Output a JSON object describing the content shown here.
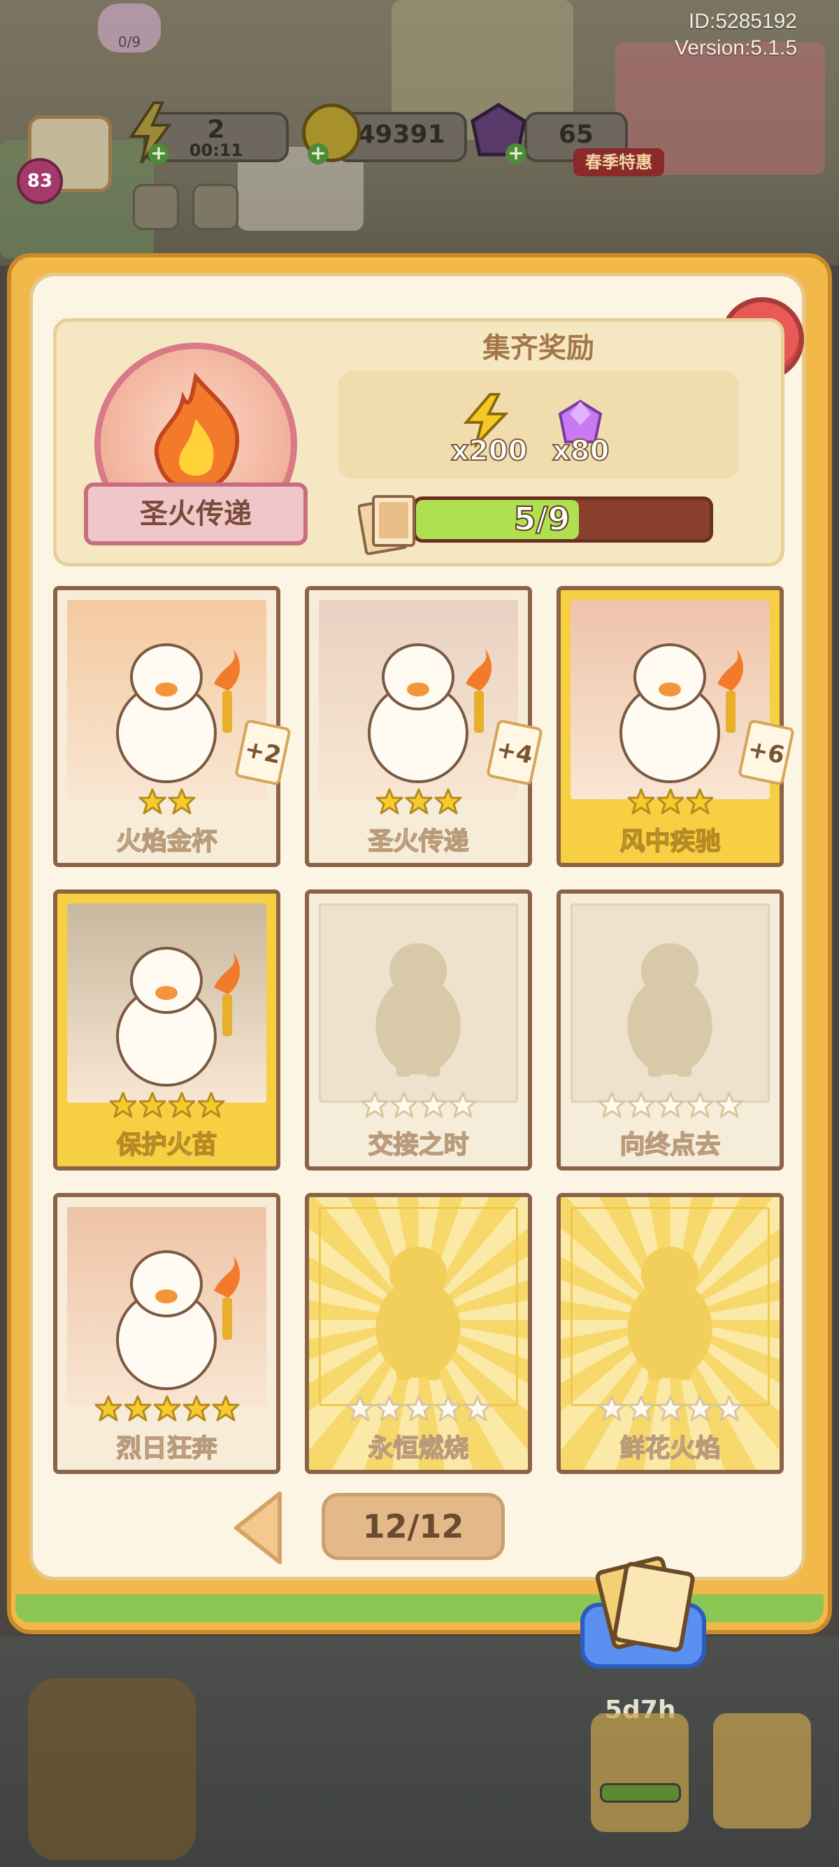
{
  "system": {
    "id_label": "ID:5285192",
    "version_label": "Version:5.1.5"
  },
  "hud": {
    "level": "83",
    "energy_count": "2",
    "energy_timer": "00:11",
    "coins": "49391",
    "gems": "65",
    "gem_badge": "春季特惠",
    "top_badge": "0/9"
  },
  "album": {
    "set_name": "圣火传递",
    "header_title": "集齐奖励",
    "reward_energy": "x200",
    "reward_gems": "x80",
    "progress_text": "5/9",
    "progress_fraction": 0.5556,
    "page_indicator": "12/12"
  },
  "cards": [
    {
      "name": "火焰金杯",
      "stars": 2,
      "max_stars": 2,
      "dup": "+2",
      "state": "normal"
    },
    {
      "name": "圣火传递",
      "stars": 3,
      "max_stars": 3,
      "dup": "+4",
      "state": "normal"
    },
    {
      "name": "风中疾驰",
      "stars": 3,
      "max_stars": 3,
      "dup": "+6",
      "state": "gold"
    },
    {
      "name": "保护火苗",
      "stars": 4,
      "max_stars": 4,
      "dup": "",
      "state": "gold"
    },
    {
      "name": "交接之时",
      "stars": 0,
      "max_stars": 4,
      "dup": "",
      "state": "locked"
    },
    {
      "name": "向终点去",
      "stars": 0,
      "max_stars": 5,
      "dup": "",
      "state": "locked"
    },
    {
      "name": "烈日狂奔",
      "stars": 5,
      "max_stars": 5,
      "dup": "",
      "state": "normal"
    },
    {
      "name": "永恒燃烧",
      "stars": 0,
      "max_stars": 5,
      "dup": "",
      "state": "lockedgold"
    },
    {
      "name": "鲜花火焰",
      "stars": 0,
      "max_stars": 5,
      "dup": "",
      "state": "lockedgold"
    }
  ],
  "bottom": {
    "timer": "5d7h"
  },
  "colors": {
    "accent": "#f2b84a",
    "close": "#e75a55",
    "progress": "#aee050",
    "card_border": "#8b6448"
  }
}
